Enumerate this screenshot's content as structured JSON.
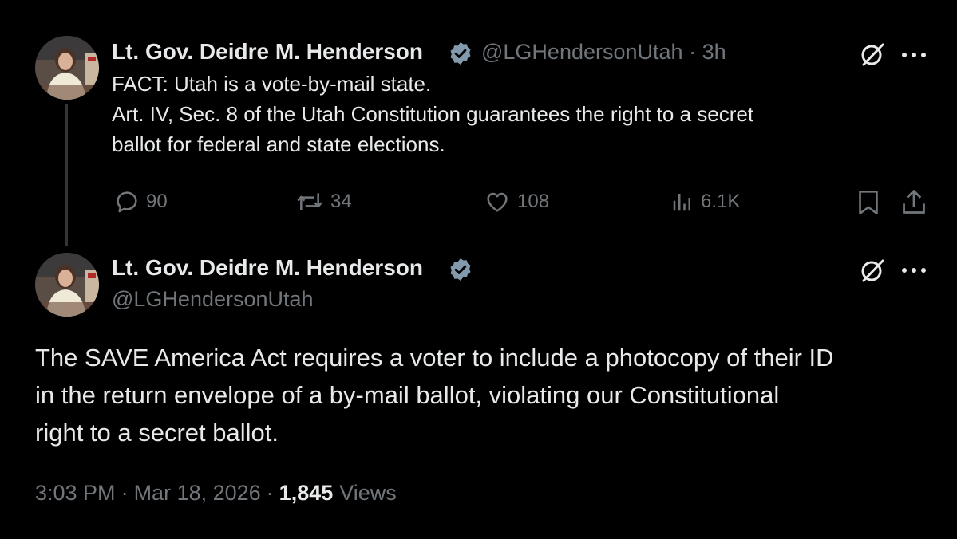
{
  "tweet1": {
    "author_name": "Lt. Gov. Deidre M. Henderson",
    "handle": "@LGHendersonUtah",
    "separator": "·",
    "time_ago": "3h",
    "text_lines": [
      "FACT: Utah is a vote-by-mail state.",
      "Art. IV, Sec. 8 of the Utah Constitution guarantees the right to a secret",
      "ballot for federal and state elections."
    ],
    "replies": "90",
    "reposts": "34",
    "likes": "108",
    "views": "6.1K"
  },
  "tweet2": {
    "author_name": "Lt. Gov. Deidre M. Henderson",
    "handle": "@LGHendersonUtah",
    "text_lines": [
      "The SAVE America Act requires a voter to include a photocopy of their ID",
      "in the return envelope of a by-mail ballot, violating our Constitutional",
      "right to a secret ballot."
    ],
    "time": "3:03 PM",
    "separator": "·",
    "date": "Mar 18, 2026",
    "separator2": "·",
    "views_count": "1,845",
    "views_label": "Views"
  },
  "colors": {
    "background": "#000000",
    "primary_text": "#e7e9ea",
    "secondary_text": "#71767b",
    "verified_badge": "#829aab"
  },
  "icons": [
    "grok-icon",
    "more-icon",
    "reply-icon",
    "repost-icon",
    "like-icon",
    "views-icon",
    "bookmark-icon",
    "share-icon",
    "verified-badge-icon"
  ]
}
